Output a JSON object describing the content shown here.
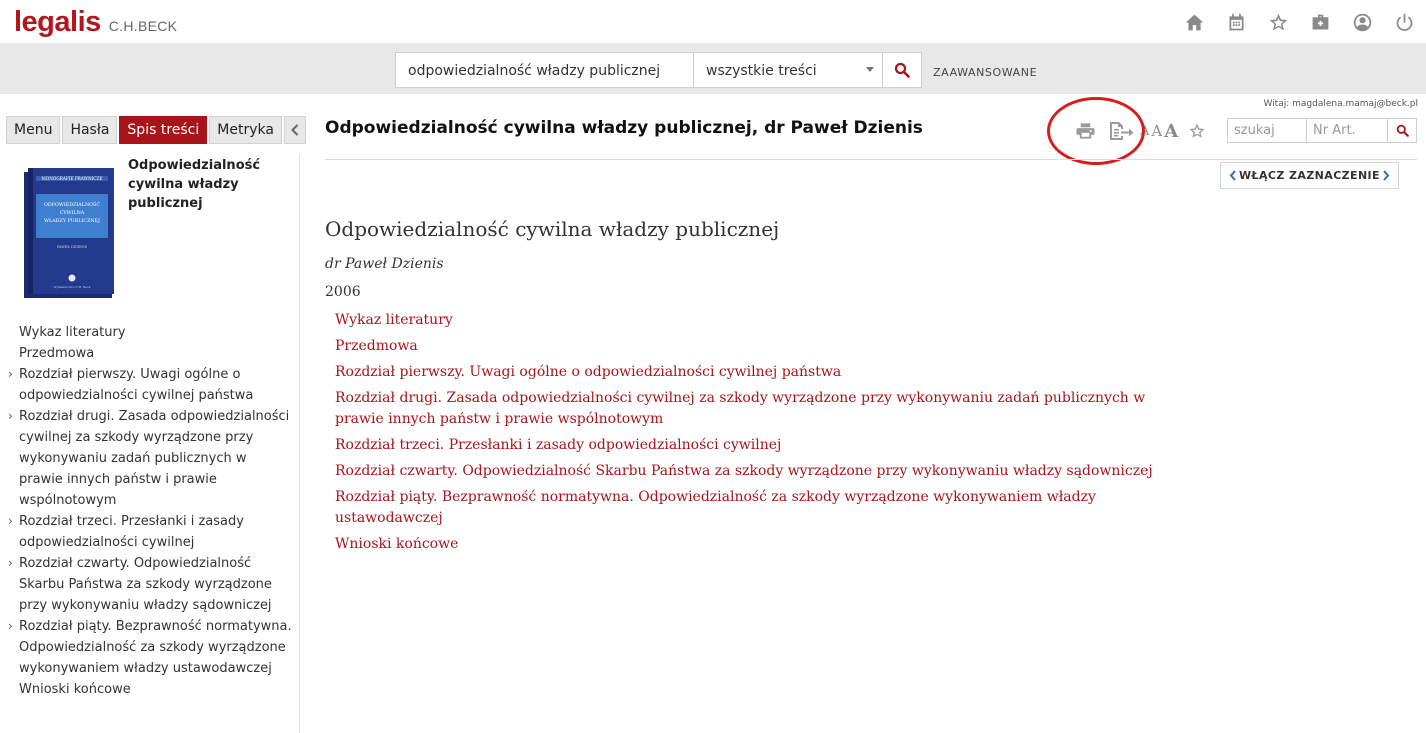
{
  "brand": {
    "name": "legalis",
    "publisher": "C.H.BECK"
  },
  "top_icons": [
    "home-icon",
    "calendar-icon",
    "star-icon",
    "briefcase-icon",
    "user-icon",
    "power-icon"
  ],
  "search": {
    "query": "odpowiedzialność władzy publicznej",
    "scope": "wszystkie treści",
    "advanced_label": "ZAAWANSOWANE"
  },
  "user": {
    "welcome": "Witaj: magdalena.mamaj@beck.pl"
  },
  "left_tabs": [
    {
      "label": "Menu",
      "active": false
    },
    {
      "label": "Hasła",
      "active": false
    },
    {
      "label": "Spis treści",
      "active": true
    },
    {
      "label": "Metryka",
      "active": false
    }
  ],
  "book": {
    "title": "Odpowiedzialność cywilna władzy publicznej",
    "cover_series": "MONOGRAFIE PRAWNICZE",
    "cover_title_lines": [
      "ODPOWIEDZIALNOŚĆ",
      "CYWILNA",
      "WŁADZY PUBLICZNEJ"
    ],
    "cover_author": "PAWEŁ DZIENIS",
    "cover_publisher": "Wydawnictwo C.H. Beck"
  },
  "toc": [
    {
      "label": "Wykaz literatury",
      "expandable": false
    },
    {
      "label": "Przedmowa",
      "expandable": false
    },
    {
      "label": "Rozdział pierwszy. Uwagi ogólne o odpowiedzialności cywilnej państwa",
      "expandable": true
    },
    {
      "label": "Rozdział drugi. Zasada odpowiedzialności cywilnej za szkody wyrządzone przy wykonywaniu zadań publicznych w prawie innych państw i prawie wspólnotowym",
      "expandable": true
    },
    {
      "label": "Rozdział trzeci. Przesłanki i zasady odpowiedzialności cywilnej",
      "expandable": true
    },
    {
      "label": "Rozdział czwarty. Odpowiedzialność Skarbu Państwa za szkody wyrządzone przy wykonywaniu władzy sądowniczej",
      "expandable": true
    },
    {
      "label": "Rozdział piąty. Bezprawność normatywna. Odpowiedzialność za szkody wyrządzone wykonywaniem władzy ustawodawczej",
      "expandable": true
    },
    {
      "label": "Wnioski końcowe",
      "expandable": false
    }
  ],
  "document": {
    "title": "Odpowiedzialność cywilna władzy publicznej, dr Paweł Dzienis",
    "search_placeholder": "szukaj",
    "article_placeholder": "Nr Art.",
    "highlight_label": "WŁĄCZ ZAZNACZENIE",
    "heading": "Odpowiedzialność cywilna władzy publicznej",
    "author": "dr Paweł Dzienis",
    "year": "2006",
    "font_small": "A",
    "font_mid": "A",
    "font_big": "A",
    "links": [
      "Wykaz literatury",
      "Przedmowa",
      "Rozdział pierwszy. Uwagi ogólne o odpowiedzialności cywilnej państwa",
      "Rozdział drugi. Zasada odpowiedzialności cywilnej za szkody wyrządzone przy wykonywaniu zadań publicznych w prawie innych państw i prawie wspólnotowym",
      "Rozdział trzeci. Przesłanki i zasady odpowiedzialności cywilnej",
      "Rozdział czwarty. Odpowiedzialność Skarbu Państwa za szkody wyrządzone przy wykonywaniu władzy sądowniczej",
      "Rozdział piąty. Bezprawność normatywna. Odpowiedzialność za szkody wyrządzone wykonywaniem władzy ustawodawczej",
      "Wnioski końcowe"
    ]
  },
  "colors": {
    "brand": "#b3161c",
    "active_tab": "#a8141a",
    "link": "#a8141a",
    "annotation": "#d51f1f"
  }
}
